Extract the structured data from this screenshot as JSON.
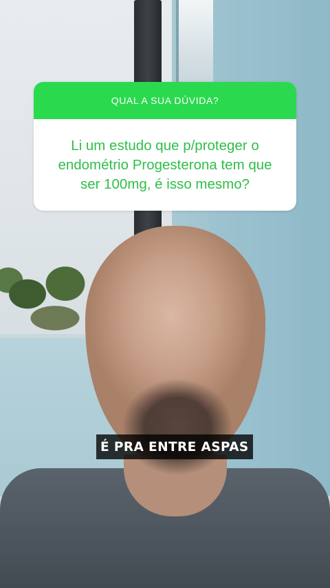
{
  "question_sticker": {
    "title": "QUAL A SUA DÚVIDA?",
    "text": "Li um estudo que p/proteger o endométrio Progesterona tem que ser 100mg, é isso mesmo?",
    "header_color": "#2bd94f",
    "text_color": "#2fbe49"
  },
  "caption": {
    "text": "É PRA ENTRE ASPAS"
  }
}
